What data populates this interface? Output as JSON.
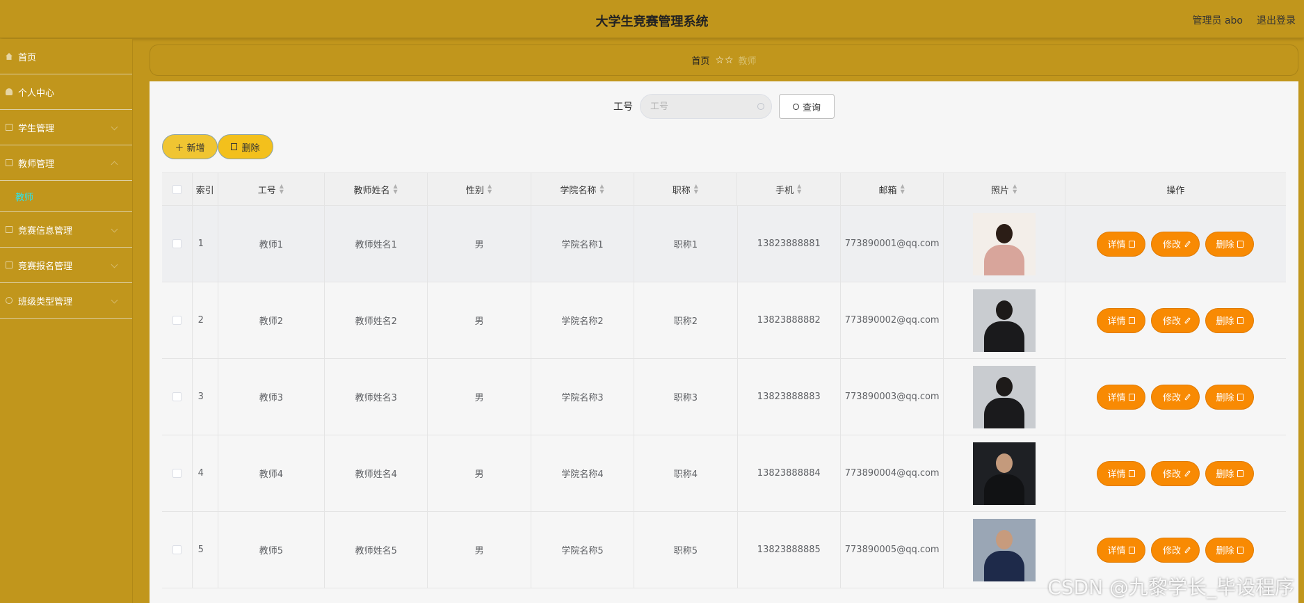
{
  "header": {
    "title": "大学生竞赛管理系统",
    "user": "管理员 abo",
    "logout": "退出登录"
  },
  "sidebar": {
    "items": [
      {
        "label": "首页",
        "icon": "home-icon"
      },
      {
        "label": "个人中心",
        "icon": "person-icon"
      },
      {
        "label": "学生管理",
        "icon": "folder-icon"
      },
      {
        "label": "教师管理",
        "icon": "folder-icon",
        "active_child": "教师"
      },
      {
        "label": "竞赛信息管理",
        "icon": "folder-icon"
      },
      {
        "label": "竞赛报名管理",
        "icon": "folder-icon"
      },
      {
        "label": "班级类型管理",
        "icon": "circle-icon"
      }
    ]
  },
  "breadcrumb": {
    "home": "首页",
    "stars": "☆☆",
    "current": "教师"
  },
  "search": {
    "label": "工号",
    "placeholder": "工号",
    "button": "查询"
  },
  "actions": {
    "add": "＋ 新增",
    "delete": "删除"
  },
  "table": {
    "headers": {
      "index": "索引",
      "id": "工号",
      "name": "教师姓名",
      "gender": "性别",
      "college": "学院名称",
      "title": "职称",
      "phone": "手机",
      "email": "邮箱",
      "photo": "照片",
      "ops": "操作"
    },
    "rows": [
      {
        "index": "1",
        "id": "教师1",
        "name": "教师姓名1",
        "gender": "男",
        "college": "学院名称1",
        "title": "职称1",
        "phone": "13823888881",
        "email": "773890001@qq.com"
      },
      {
        "index": "2",
        "id": "教师2",
        "name": "教师姓名2",
        "gender": "男",
        "college": "学院名称2",
        "title": "职称2",
        "phone": "13823888882",
        "email": "773890002@qq.com"
      },
      {
        "index": "3",
        "id": "教师3",
        "name": "教师姓名3",
        "gender": "男",
        "college": "学院名称3",
        "title": "职称3",
        "phone": "13823888883",
        "email": "773890003@qq.com"
      },
      {
        "index": "4",
        "id": "教师4",
        "name": "教师姓名4",
        "gender": "男",
        "college": "学院名称4",
        "title": "职称4",
        "phone": "13823888884",
        "email": "773890004@qq.com"
      },
      {
        "index": "5",
        "id": "教师5",
        "name": "教师姓名5",
        "gender": "男",
        "college": "学院名称5",
        "title": "职称5",
        "phone": "13823888885",
        "email": "773890005@qq.com"
      }
    ],
    "row_buttons": {
      "detail": "详情",
      "edit": "修改",
      "delete": "删除"
    }
  },
  "watermark": "CSDN @九黎学长_毕设程序",
  "colors": {
    "accent": "#c1961c",
    "button_orange": "#f88a03",
    "submenu_active": "#2ce3ec"
  }
}
